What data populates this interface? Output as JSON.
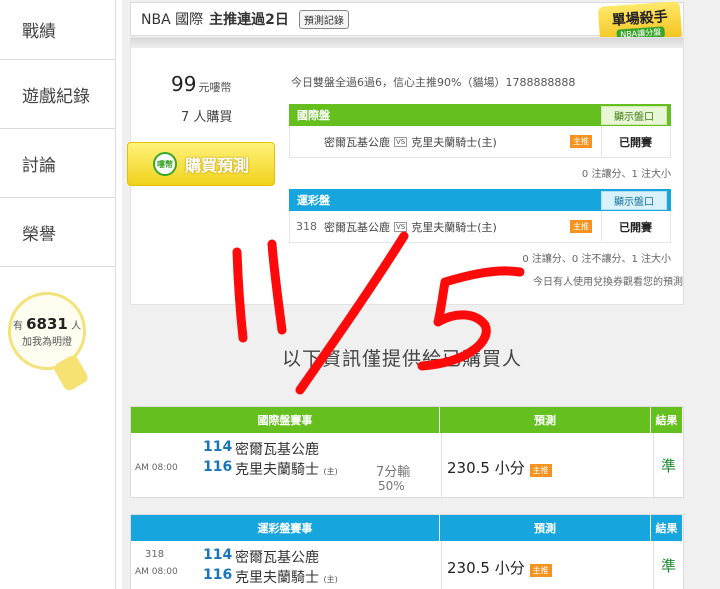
{
  "sidebar": {
    "items": [
      {
        "label": "戰績"
      },
      {
        "label": "遊戲紀錄"
      },
      {
        "label": "討論"
      },
      {
        "label": "榮譽"
      }
    ],
    "bulb": {
      "prefix": "有",
      "count": "6831",
      "suffix": "人",
      "caption": "加我為明燈"
    }
  },
  "header": {
    "league": "NBA 國際",
    "streak": "主推連過2日",
    "record_button": "預測記錄",
    "badge_title": "單場殺手",
    "badge_sub": "NBA讓分盤"
  },
  "offer": {
    "price": "99",
    "price_unit": "元嘍幣",
    "buyers": "7 人購買",
    "buy_button": "購買預測",
    "buy_icon": "嘍幣",
    "summary": "今日雙盤全過6過6，信心主推90%（貓場）1788888888"
  },
  "intl_panel": {
    "title": "國際盤",
    "show_button": "顯示盤口",
    "away": "密爾瓦基公鹿",
    "vs": "VS",
    "home": "克里夫蘭騎士(主)",
    "tag": "主推",
    "status": "已開賽",
    "note": "0 注讓分、1 注大小"
  },
  "lottery_panel": {
    "title": "運彩盤",
    "show_button": "顯示盤口",
    "code": "318",
    "away": "密爾瓦基公鹿",
    "vs": "VS",
    "home": "克里夫蘭騎士(主)",
    "tag": "主推",
    "status": "已開賽",
    "note": "0 注讓分、0 注不讓分、1 注大小",
    "coupon_note": "今日有人使用兌換券觀看您的預測"
  },
  "locked_text": "以下資訊僅提供給已購買人",
  "intl_table": {
    "headers": [
      "國際盤賽事",
      "預測",
      "結果"
    ],
    "time": "AM 08:00",
    "away_code": "114",
    "away_team": "密爾瓦基公鹿",
    "home_code": "116",
    "home_team": "克里夫蘭騎士",
    "home_mark": "(主)",
    "result": "7分輸",
    "percent": "50%",
    "prediction": "230.5 小分",
    "tag": "主推",
    "outcome": "準"
  },
  "lottery_table": {
    "headers": [
      "運彩盤賽事",
      "預測",
      "結果"
    ],
    "code": "318",
    "time": "AM 08:00",
    "away_code": "114",
    "away_team": "密爾瓦基公鹿",
    "home_code": "116",
    "home_team": "克里夫蘭騎士",
    "home_mark": "(主)",
    "prediction": "230.5 小分",
    "tag": "主推",
    "outcome": "準"
  },
  "colors": {
    "green": "#65bf1e",
    "blue": "#17a5de",
    "ink": "#ff0000",
    "accent": "#f7921e"
  }
}
